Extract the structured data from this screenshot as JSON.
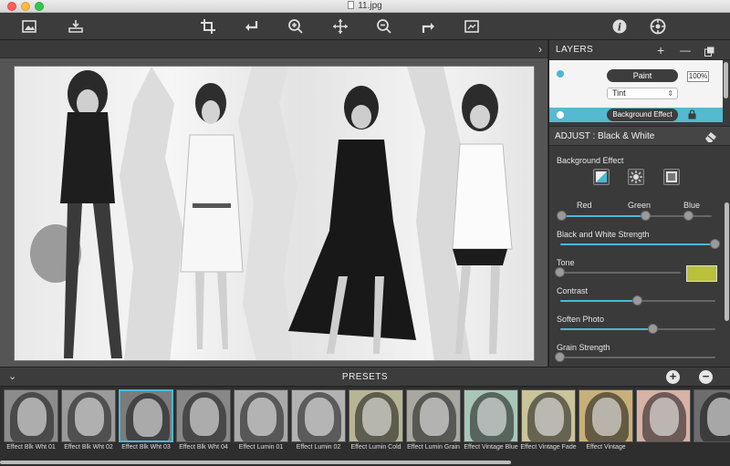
{
  "window": {
    "title": "11.jpg"
  },
  "toolbar": {
    "left": [
      "image-icon",
      "import-icon"
    ],
    "center": [
      "crop-icon",
      "undo-icon",
      "zoom-in-icon",
      "move-icon",
      "zoom-out-icon",
      "redo-icon",
      "fit-image-icon"
    ],
    "right": [
      "info-icon",
      "settings-icon"
    ]
  },
  "layers": {
    "title": "LAYERS",
    "add_label": "+",
    "remove_label": "—",
    "items": [
      {
        "name": "Paint",
        "opacity": "100%",
        "blend": "Tint"
      },
      {
        "name": "Background Effect"
      }
    ]
  },
  "adjust": {
    "title": "ADJUST : Black & White",
    "background_effect_label": "Background Effect",
    "channels": {
      "red": "Red",
      "green": "Green",
      "blue": "Blue"
    },
    "channel_values": {
      "red": 0.0,
      "green": 0.56,
      "blue": 0.85
    },
    "sliders": [
      {
        "label": "Black and White Strength",
        "value": 1.0
      },
      {
        "label": "Tone",
        "value": 0.0
      },
      {
        "label": "Contrast",
        "value": 0.5
      },
      {
        "label": "Soften Photo",
        "value": 0.6
      },
      {
        "label": "Grain Strength",
        "value": 0.0
      }
    ],
    "tone_color": "#b9c03a"
  },
  "presets": {
    "title": "PRESETS",
    "add_label": "+",
    "remove_label": "−",
    "items": [
      {
        "name": "Effect Blk Wht 01",
        "tint": "#8c8c8c"
      },
      {
        "name": "Effect Blk Wht 02",
        "tint": "#9a9a9a"
      },
      {
        "name": "Effect Blk Wht 03",
        "tint": "#7c7c7c",
        "selected": true
      },
      {
        "name": "Effect Blk Wht 04",
        "tint": "#888888"
      },
      {
        "name": "Effect Lumin 01",
        "tint": "#a9a9a9"
      },
      {
        "name": "Effect Lumin 02",
        "tint": "#b2b2b2"
      },
      {
        "name": "Effect Lumin Cold",
        "tint": "#b7b596"
      },
      {
        "name": "Effect Lumin Grain",
        "tint": "#a8a8a0"
      },
      {
        "name": "Effect Vintage Blue",
        "tint": "#a9c7b8"
      },
      {
        "name": "Effect Vintage Fade",
        "tint": "#c9c49a"
      },
      {
        "name": "Effect Vintage",
        "tint": "#c8b07a"
      },
      {
        "name": "",
        "tint": "#d7b2a6"
      },
      {
        "name": "",
        "tint": "#6d6d6d"
      }
    ]
  },
  "colors": {
    "accent": "#4ab8d6",
    "panel": "#3a3a3a"
  }
}
